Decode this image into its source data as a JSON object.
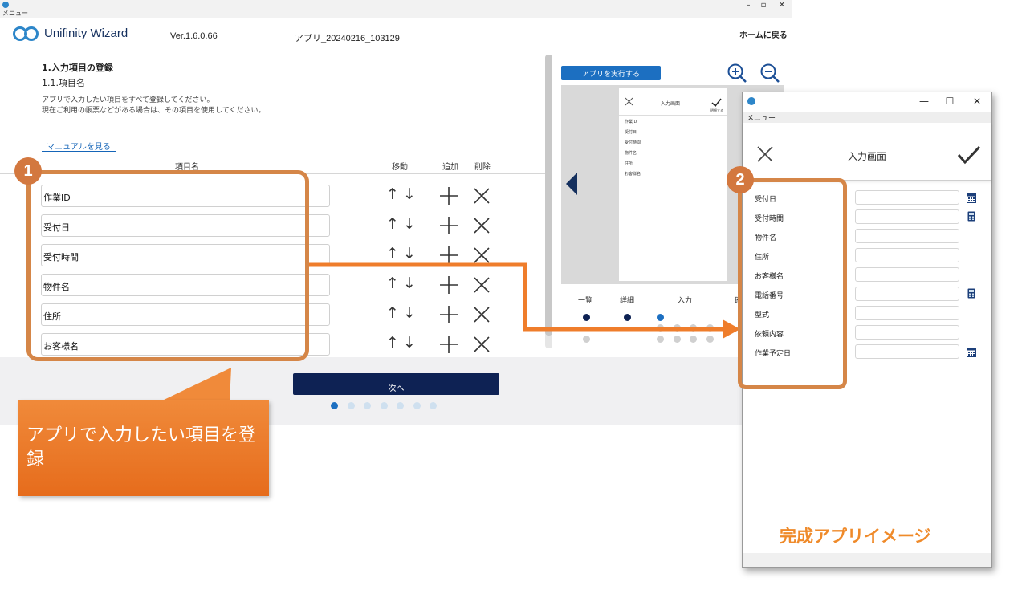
{
  "window": {
    "menu_label": "メニュー",
    "controls": [
      "–",
      "▫",
      "✕"
    ]
  },
  "header": {
    "logo_text": "Unifinity Wizard",
    "version": "Ver.1.6.0.66",
    "app_name": "アプリ_20240216_103129",
    "home_link": "ホームに戻る"
  },
  "section": {
    "title": "1.入力項目の登録",
    "subtitle": "1.1.項目名",
    "desc_line1": "アプリで入力したい項目をすべて登録してください。",
    "desc_line2": "現在ご利用の帳票などがある場合は、その項目を使用してください。",
    "manual_link": "マニュアルを見る"
  },
  "columns": {
    "name": "項目名",
    "move": "移動",
    "add": "追加",
    "delete": "削除"
  },
  "arrows": {
    "up": "↑",
    "down": "↓"
  },
  "items": [
    "作業ID",
    "受付日",
    "受付時間",
    "物件名",
    "住所",
    "お客様名"
  ],
  "icons": {
    "add": "plus-icon",
    "delete": "close-icon",
    "calc": "calculator-icon",
    "calendar": "calendar-icon",
    "check": "check-icon"
  },
  "next_button": "次へ",
  "wizard_steps_total": 7,
  "wizard_step_current": 1,
  "preview": {
    "run_button": "アプリを実行する",
    "mini_title": "入力画面",
    "mini_done": "明細する",
    "mini_fields": [
      "作業ID",
      "受付日",
      "受付時間",
      "物件名",
      "住所",
      "お客様名"
    ],
    "steps": [
      "一覧",
      "詳細",
      "入力",
      "確"
    ]
  },
  "callouts": {
    "badge1": "1",
    "badge2": "2",
    "tip_text": "アプリで入力したい項目を登録",
    "complete_label": "完成アプリイメージ"
  },
  "colors": {
    "navy": "#0e2254",
    "blue": "#1c6fc1",
    "orange": "#e66c1c",
    "callout_border": "#d58648"
  },
  "app_window": {
    "menu_label": "メニュー",
    "title": "入力画面",
    "controls": [
      "—",
      "☐",
      "✕"
    ],
    "fields": [
      "受付日",
      "受付時間",
      "物件名",
      "住所",
      "お客様名",
      "電話番号",
      "型式",
      "依頼内容",
      "作業予定日"
    ]
  }
}
